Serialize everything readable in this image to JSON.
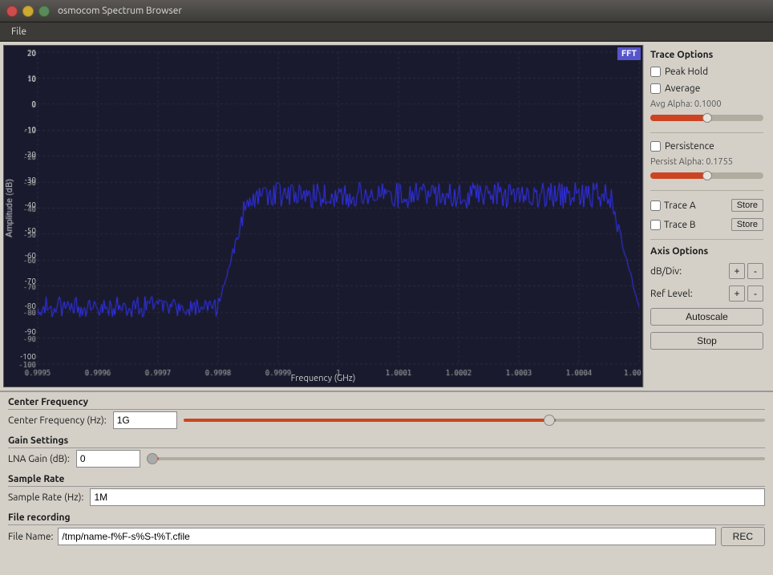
{
  "window": {
    "title": "osmocom Spectrum Browser",
    "buttons": {
      "close": "×",
      "minimize": "−",
      "maximize": "□"
    }
  },
  "menu": {
    "items": [
      "File"
    ]
  },
  "chart": {
    "fft_label": "FFT",
    "x_axis_label": "Frequency (GHz)",
    "y_axis_label": "Amplitude (dB)",
    "y_ticks": [
      "20",
      "10",
      "0",
      "-10",
      "-20",
      "-30",
      "-40",
      "-50",
      "-60",
      "-70",
      "-80",
      "-90",
      "-100"
    ],
    "x_ticks": [
      "0.9995",
      "0.9996",
      "0.9997",
      "0.9998",
      "0.9999",
      "1",
      "1.0001",
      "1.0002",
      "1.0003",
      "1.0004",
      "1.00..."
    ]
  },
  "trace_options": {
    "title": "Trace Options",
    "peak_hold": {
      "label": "Peak Hold",
      "checked": false
    },
    "average": {
      "label": "Average",
      "checked": false
    },
    "avg_alpha_label": "Avg Alpha: 0.1000",
    "avg_alpha_value": 0.5,
    "persistence": {
      "label": "Persistence",
      "checked": false
    },
    "persist_alpha_label": "Persist Alpha: 0.1755",
    "persist_alpha_value": 0.5,
    "trace_a": {
      "label": "Trace A",
      "checked": false
    },
    "trace_b": {
      "label": "Trace B",
      "checked": false
    },
    "store_label": "Store",
    "axis_options": {
      "title": "Axis Options",
      "db_div": {
        "label": "dB/Div:",
        "plus": "+",
        "minus": "-"
      },
      "ref_level": {
        "label": "Ref Level:",
        "plus": "+",
        "minus": "-"
      }
    },
    "autoscale_label": "Autoscale",
    "stop_label": "Stop"
  },
  "center_frequency": {
    "title": "Center Frequency",
    "label": "Center Frequency (Hz):",
    "value": "1G",
    "slider_pct": 64
  },
  "gain_settings": {
    "title": "Gain Settings",
    "label": "LNA Gain (dB):",
    "value": "0",
    "slider_pct": 2
  },
  "sample_rate": {
    "title": "Sample Rate",
    "label": "Sample Rate (Hz):",
    "value": "1M"
  },
  "file_recording": {
    "title": "File recording",
    "label": "File Name:",
    "value": "/tmp/name-f%F-s%S-t%T.cfile",
    "rec_label": "REC"
  }
}
